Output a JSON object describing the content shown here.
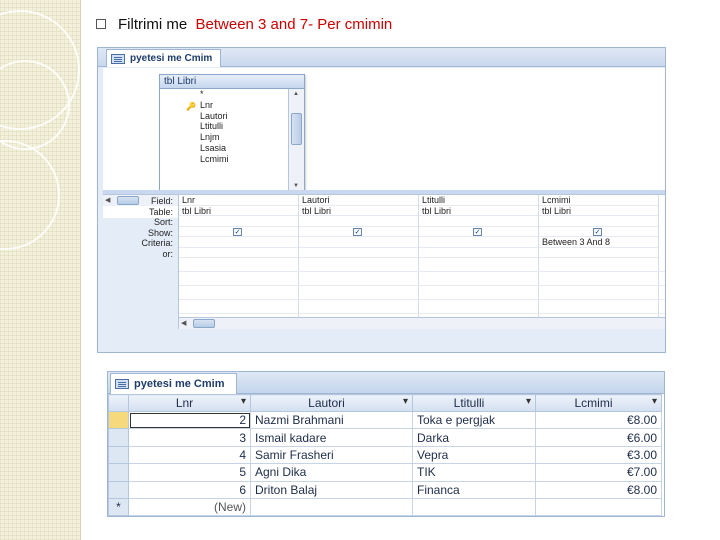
{
  "slide": {
    "heading_plain": "Filtrimi me",
    "heading_accent": "Between 3 and 7- Per cmimin"
  },
  "design_view": {
    "tab_title": "pyetesi me Cmim",
    "field_list": {
      "title": "tbl Libri",
      "items": [
        "*",
        "Lnr",
        "Lautori",
        "Ltitulli",
        "Lnjm",
        "Lsasia",
        "Lcmimi"
      ],
      "key_item_index": 1
    },
    "row_labels": [
      "Field:",
      "Table:",
      "Sort:",
      "Show:",
      "Criteria:",
      "or:"
    ],
    "columns": [
      {
        "field": "Lnr",
        "table": "tbl Libri",
        "sort": "",
        "show": true,
        "criteria": ""
      },
      {
        "field": "Lautori",
        "table": "tbl Libri",
        "sort": "",
        "show": true,
        "criteria": ""
      },
      {
        "field": "Ltitulli",
        "table": "tbl Libri",
        "sort": "",
        "show": true,
        "criteria": ""
      },
      {
        "field": "Lcmimi",
        "table": "tbl Libri",
        "sort": "",
        "show": true,
        "criteria": "Between 3 And 8"
      }
    ]
  },
  "datasheet": {
    "tab_title": "pyetesi me Cmim",
    "headers": [
      "Lnr",
      "Lautori",
      "Ltitulli",
      "Lcmimi"
    ],
    "rows": [
      {
        "lnr": "2",
        "lautori": "Nazmi Brahmani",
        "ltitulli": "Toka e pergjak",
        "lcmimi": "€8.00"
      },
      {
        "lnr": "3",
        "lautori": "Ismail kadare",
        "ltitulli": "Darka",
        "lcmimi": "€6.00"
      },
      {
        "lnr": "4",
        "lautori": "Samir Frasheri",
        "ltitulli": "Vepra",
        "lcmimi": "€3.00"
      },
      {
        "lnr": "5",
        "lautori": "Agni Dika",
        "ltitulli": "TIK",
        "lcmimi": "€7.00"
      },
      {
        "lnr": "6",
        "lautori": "Driton Balaj",
        "ltitulli": "Financa",
        "lcmimi": "€8.00"
      }
    ],
    "new_row_marker": "*",
    "new_row_label": "(New)"
  }
}
